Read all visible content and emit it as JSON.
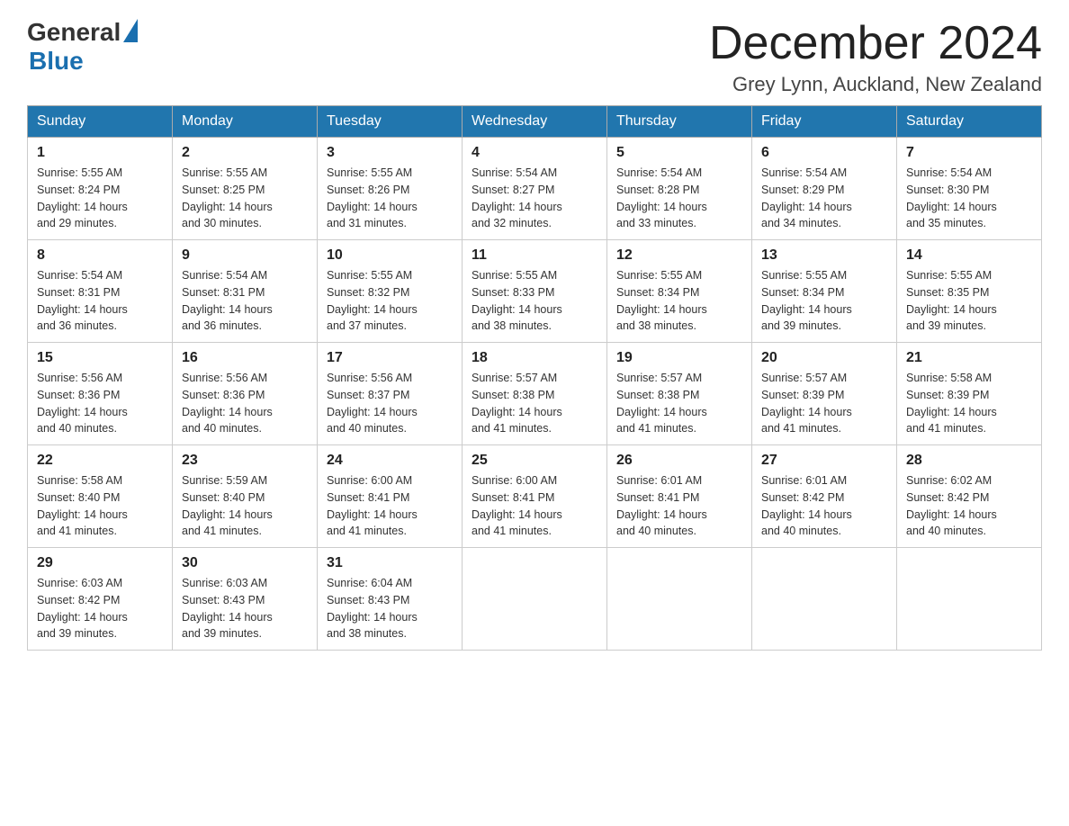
{
  "logo": {
    "general": "General",
    "blue": "Blue"
  },
  "title": "December 2024",
  "subtitle": "Grey Lynn, Auckland, New Zealand",
  "days_of_week": [
    "Sunday",
    "Monday",
    "Tuesday",
    "Wednesday",
    "Thursday",
    "Friday",
    "Saturday"
  ],
  "weeks": [
    [
      {
        "day": "1",
        "sunrise": "5:55 AM",
        "sunset": "8:24 PM",
        "daylight": "14 hours and 29 minutes."
      },
      {
        "day": "2",
        "sunrise": "5:55 AM",
        "sunset": "8:25 PM",
        "daylight": "14 hours and 30 minutes."
      },
      {
        "day": "3",
        "sunrise": "5:55 AM",
        "sunset": "8:26 PM",
        "daylight": "14 hours and 31 minutes."
      },
      {
        "day": "4",
        "sunrise": "5:54 AM",
        "sunset": "8:27 PM",
        "daylight": "14 hours and 32 minutes."
      },
      {
        "day": "5",
        "sunrise": "5:54 AM",
        "sunset": "8:28 PM",
        "daylight": "14 hours and 33 minutes."
      },
      {
        "day": "6",
        "sunrise": "5:54 AM",
        "sunset": "8:29 PM",
        "daylight": "14 hours and 34 minutes."
      },
      {
        "day": "7",
        "sunrise": "5:54 AM",
        "sunset": "8:30 PM",
        "daylight": "14 hours and 35 minutes."
      }
    ],
    [
      {
        "day": "8",
        "sunrise": "5:54 AM",
        "sunset": "8:31 PM",
        "daylight": "14 hours and 36 minutes."
      },
      {
        "day": "9",
        "sunrise": "5:54 AM",
        "sunset": "8:31 PM",
        "daylight": "14 hours and 36 minutes."
      },
      {
        "day": "10",
        "sunrise": "5:55 AM",
        "sunset": "8:32 PM",
        "daylight": "14 hours and 37 minutes."
      },
      {
        "day": "11",
        "sunrise": "5:55 AM",
        "sunset": "8:33 PM",
        "daylight": "14 hours and 38 minutes."
      },
      {
        "day": "12",
        "sunrise": "5:55 AM",
        "sunset": "8:34 PM",
        "daylight": "14 hours and 38 minutes."
      },
      {
        "day": "13",
        "sunrise": "5:55 AM",
        "sunset": "8:34 PM",
        "daylight": "14 hours and 39 minutes."
      },
      {
        "day": "14",
        "sunrise": "5:55 AM",
        "sunset": "8:35 PM",
        "daylight": "14 hours and 39 minutes."
      }
    ],
    [
      {
        "day": "15",
        "sunrise": "5:56 AM",
        "sunset": "8:36 PM",
        "daylight": "14 hours and 40 minutes."
      },
      {
        "day": "16",
        "sunrise": "5:56 AM",
        "sunset": "8:36 PM",
        "daylight": "14 hours and 40 minutes."
      },
      {
        "day": "17",
        "sunrise": "5:56 AM",
        "sunset": "8:37 PM",
        "daylight": "14 hours and 40 minutes."
      },
      {
        "day": "18",
        "sunrise": "5:57 AM",
        "sunset": "8:38 PM",
        "daylight": "14 hours and 41 minutes."
      },
      {
        "day": "19",
        "sunrise": "5:57 AM",
        "sunset": "8:38 PM",
        "daylight": "14 hours and 41 minutes."
      },
      {
        "day": "20",
        "sunrise": "5:57 AM",
        "sunset": "8:39 PM",
        "daylight": "14 hours and 41 minutes."
      },
      {
        "day": "21",
        "sunrise": "5:58 AM",
        "sunset": "8:39 PM",
        "daylight": "14 hours and 41 minutes."
      }
    ],
    [
      {
        "day": "22",
        "sunrise": "5:58 AM",
        "sunset": "8:40 PM",
        "daylight": "14 hours and 41 minutes."
      },
      {
        "day": "23",
        "sunrise": "5:59 AM",
        "sunset": "8:40 PM",
        "daylight": "14 hours and 41 minutes."
      },
      {
        "day": "24",
        "sunrise": "6:00 AM",
        "sunset": "8:41 PM",
        "daylight": "14 hours and 41 minutes."
      },
      {
        "day": "25",
        "sunrise": "6:00 AM",
        "sunset": "8:41 PM",
        "daylight": "14 hours and 41 minutes."
      },
      {
        "day": "26",
        "sunrise": "6:01 AM",
        "sunset": "8:41 PM",
        "daylight": "14 hours and 40 minutes."
      },
      {
        "day": "27",
        "sunrise": "6:01 AM",
        "sunset": "8:42 PM",
        "daylight": "14 hours and 40 minutes."
      },
      {
        "day": "28",
        "sunrise": "6:02 AM",
        "sunset": "8:42 PM",
        "daylight": "14 hours and 40 minutes."
      }
    ],
    [
      {
        "day": "29",
        "sunrise": "6:03 AM",
        "sunset": "8:42 PM",
        "daylight": "14 hours and 39 minutes."
      },
      {
        "day": "30",
        "sunrise": "6:03 AM",
        "sunset": "8:43 PM",
        "daylight": "14 hours and 39 minutes."
      },
      {
        "day": "31",
        "sunrise": "6:04 AM",
        "sunset": "8:43 PM",
        "daylight": "14 hours and 38 minutes."
      },
      null,
      null,
      null,
      null
    ]
  ],
  "labels": {
    "sunrise": "Sunrise:",
    "sunset": "Sunset:",
    "daylight": "Daylight:"
  }
}
